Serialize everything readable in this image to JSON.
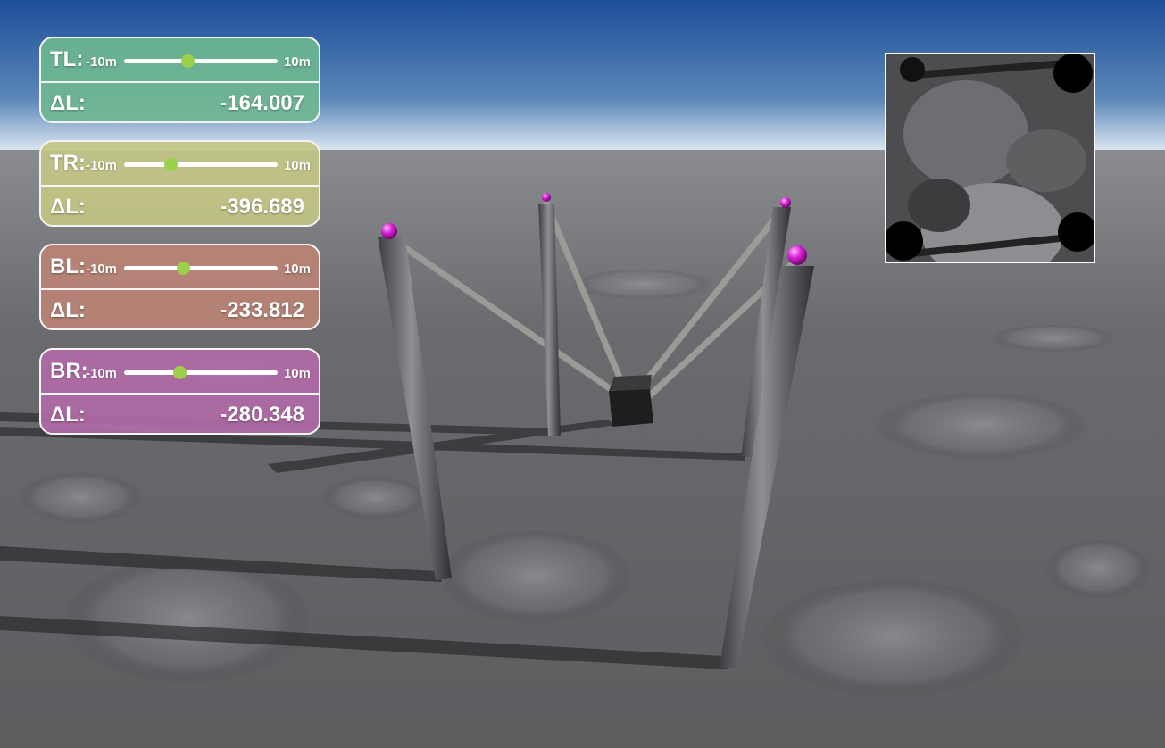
{
  "hud": {
    "cables": [
      {
        "id": "tl",
        "label": "TL:",
        "min_label": "-10m",
        "max_label": "10m",
        "slider_value": -1.7,
        "delta_label": "ΔL:",
        "delta_value": "-164.007",
        "color": "#6fb890"
      },
      {
        "id": "tr",
        "label": "TR:",
        "min_label": "-10m",
        "max_label": "10m",
        "slider_value": -4.0,
        "delta_label": "ΔL:",
        "delta_value": "-396.689",
        "color": "#c4c684"
      },
      {
        "id": "bl",
        "label": "BL:",
        "min_label": "-10m",
        "max_label": "10m",
        "slider_value": -2.3,
        "delta_label": "ΔL:",
        "delta_value": "-233.812",
        "color": "#bb8476"
      },
      {
        "id": "br",
        "label": "BR:",
        "min_label": "-10m",
        "max_label": "10m",
        "slider_value": -2.8,
        "delta_label": "ΔL:",
        "delta_value": "-280.348",
        "color": "#b46aa8"
      }
    ]
  },
  "scene": {
    "sky_top": "#1d4f9a",
    "sky_horizon": "#dde8f2",
    "ground": "#6e6e72",
    "pole_color": "#55575a",
    "cable_color": "#9c9a96",
    "marker_color": "#d81fd6",
    "payload_color": "#1e1e1e"
  },
  "minimap": {
    "view": "top-down payload camera"
  }
}
